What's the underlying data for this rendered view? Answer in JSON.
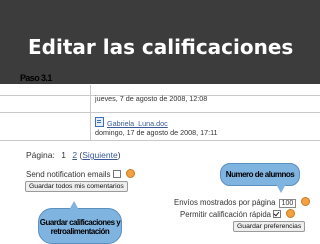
{
  "header": {
    "title": "Editar las calificaciones",
    "step": "Paso 3.1"
  },
  "attachments": [
    {
      "line1": "jueves, 7 de agosto de 2008, 12:08"
    },
    {
      "filename": "Gabriela_Luna.doc",
      "line2": "domingo, 17 de agosto de 2008, 17:11"
    }
  ],
  "pagination": {
    "label": "Página:",
    "current": "1",
    "next_page": "2",
    "next_link": "Siguiente"
  },
  "send_notification": {
    "label": "Send notification emails",
    "checked": false
  },
  "buttons": {
    "save_comments": "Guardar todos mis comentarios",
    "save_prefs": "Guardar preferencias"
  },
  "preferences": {
    "envios_label": "Envíos mostrados por página",
    "envios_value": "100",
    "quick_grade_label": "Permitir calificación rápida",
    "quick_grade_checked": true
  },
  "callouts": {
    "number_of_students": "Numero de alumnos",
    "save_feedback": "Guardar calificaciones y retroalimentación"
  }
}
